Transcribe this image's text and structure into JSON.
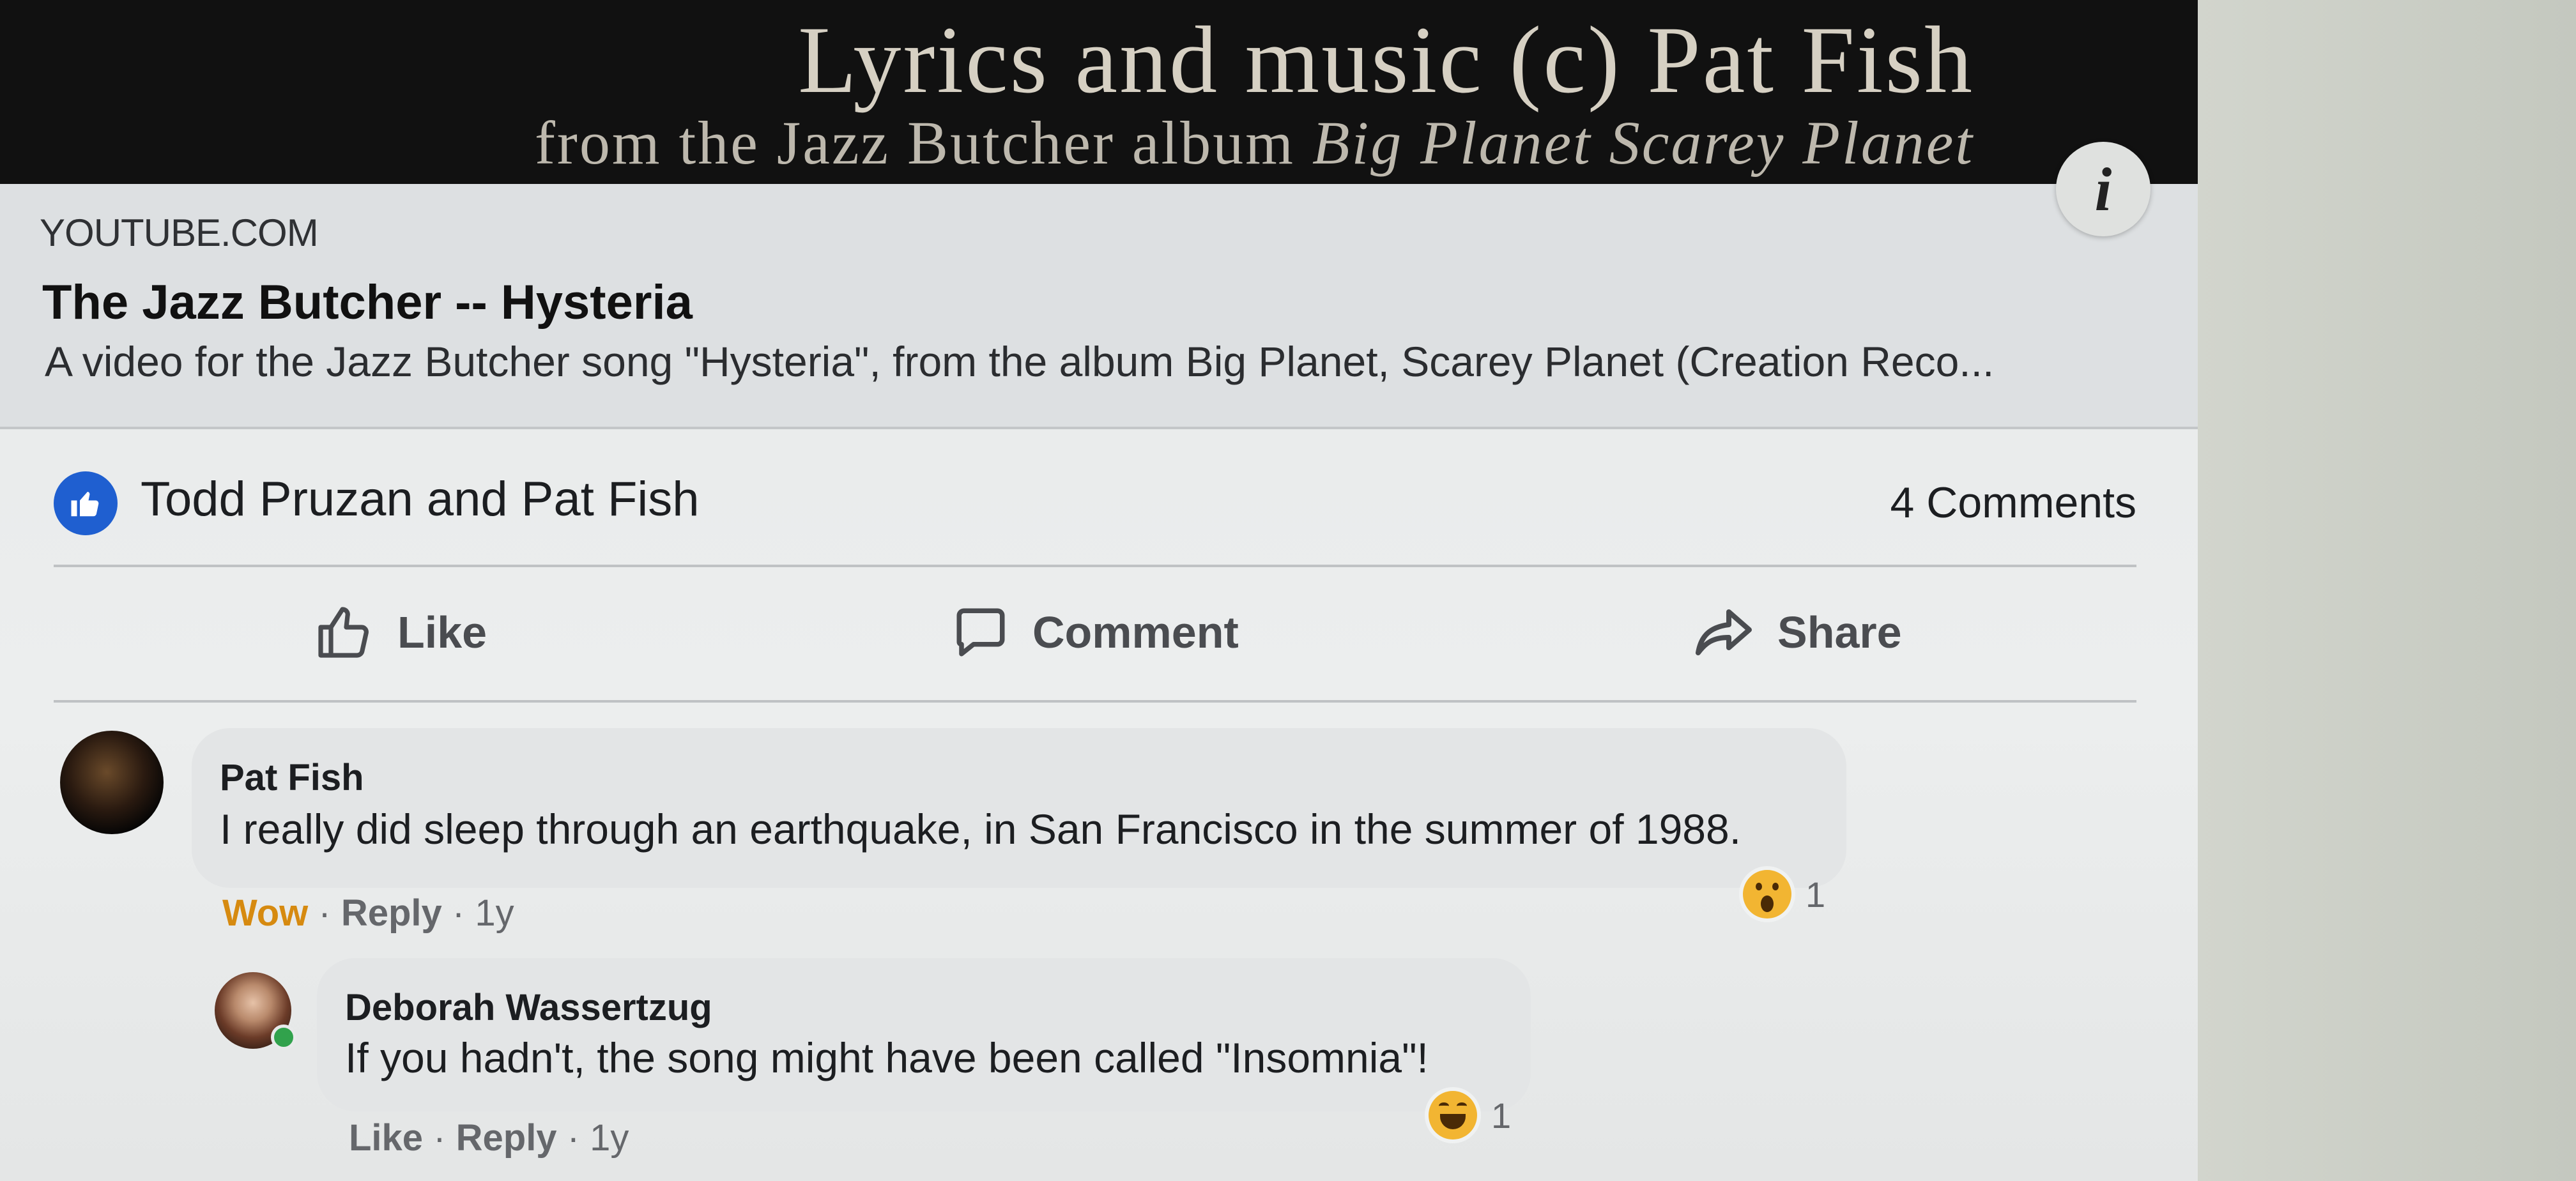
{
  "banner": {
    "title": "Lyrics and music (c) Pat Fish",
    "subtitle_prefix": "from the Jazz Butcher album ",
    "subtitle_album": "Big Planet Scarey Planet"
  },
  "link_preview": {
    "domain": "YOUTUBE.COM",
    "title": "The Jazz Butcher -- Hysteria",
    "description": "A video for the Jazz Butcher song \"Hysteria\", from the album Big Planet, Scarey Planet (Creation Reco..."
  },
  "post_stats": {
    "reactors": "Todd Pruzan and Pat Fish",
    "comments": "4 Comments"
  },
  "actions": {
    "like": "Like",
    "comment": "Comment",
    "share": "Share"
  },
  "comments": [
    {
      "author": "Pat Fish",
      "text": "I really did sleep through an earthquake, in San Francisco in the summer of 1988.",
      "my_reaction": "Wow",
      "reply": "Reply",
      "age": "1y",
      "reaction_count": "1",
      "reaction_icon": "wow-emoji-icon"
    },
    {
      "author": "Deborah Wassertzug",
      "text": "If you hadn't, the song might have been called \"Insomnia\"!",
      "like": "Like",
      "reply": "Reply",
      "age": "1y",
      "reaction_count": "1",
      "reaction_icon": "haha-emoji-icon"
    }
  ],
  "colors": {
    "like_blue": "#1f5fd0",
    "wow_orange": "#d68a10",
    "online_green": "#31a24c"
  }
}
